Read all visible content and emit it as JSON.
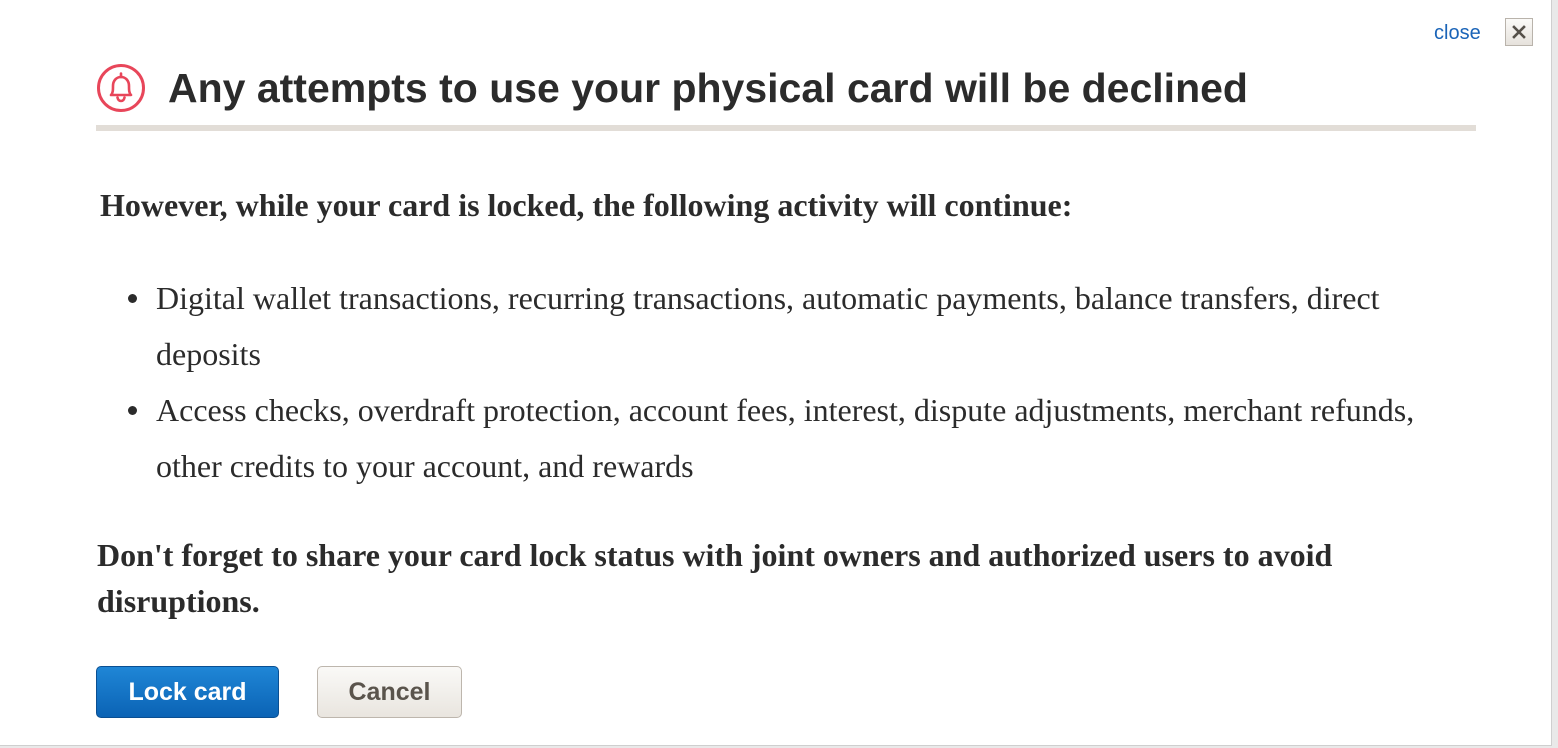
{
  "dialog": {
    "close_label": "close",
    "title": "Any attempts to use your physical card will be declined",
    "intro": "However, while your card is locked, the following activity will continue:",
    "activities": [
      "Digital wallet transactions, recurring transactions, automatic payments, balance transfers, direct deposits",
      "Access checks, overdraft protection, account fees, interest, dispute adjustments, merchant refunds, other credits to your account, and rewards"
    ],
    "note": "Don't forget to share your card lock status with joint owners and authorized users to avoid disruptions.",
    "buttons": {
      "primary": "Lock card",
      "secondary": "Cancel"
    }
  },
  "icons": {
    "header": "bell-icon",
    "close": "close-x-icon"
  },
  "colors": {
    "accent": "#0b63b5",
    "link": "#1a64b8",
    "alert_icon": "#e8465a",
    "divider": "#e2ddd7",
    "text": "#2b2b2b"
  }
}
